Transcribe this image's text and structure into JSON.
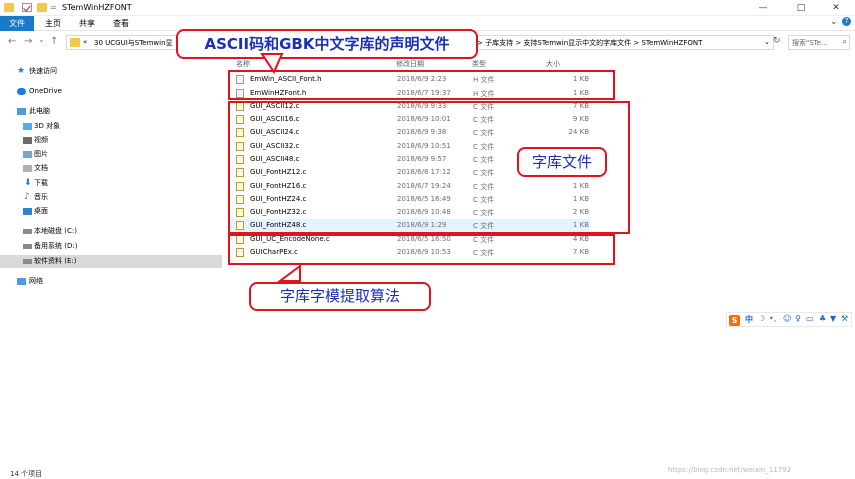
{
  "window": {
    "title": "STemWinHZFONT",
    "qa_separator": "=",
    "minimize": "—",
    "maximize": "□",
    "close": "✕"
  },
  "ribbon": {
    "tabs": [
      "文件",
      "主页",
      "共享",
      "查看"
    ],
    "expand_icon": "chevron-down-icon",
    "help_icon": "help-icon"
  },
  "address": {
    "back": "←",
    "forward": "→",
    "up_history": "⌄",
    "up": "↑",
    "crumb_lead": "«",
    "crumb_first": "30 UCGUI与STemwin显",
    "crumb_tail": ">  子库支持  >  支持STemwin显示中文的字库文件  >  STemWinHZFONT",
    "dropdown": "⌄",
    "refresh": "↻",
    "search_placeholder": "搜索\"STe...",
    "search_icon": "⌕"
  },
  "sidebar": {
    "items": [
      {
        "label": "快速访问",
        "icon": "star-icon"
      },
      {
        "label": "OneDrive",
        "icon": "cloud-icon"
      },
      {
        "label": "此电脑",
        "icon": "computer-icon"
      },
      {
        "label": "3D 对象",
        "icon": "cube-icon"
      },
      {
        "label": "视频",
        "icon": "video-icon"
      },
      {
        "label": "图片",
        "icon": "picture-icon"
      },
      {
        "label": "文档",
        "icon": "document-icon"
      },
      {
        "label": "下载",
        "icon": "download-icon"
      },
      {
        "label": "音乐",
        "icon": "music-icon"
      },
      {
        "label": "桌面",
        "icon": "desktop-icon"
      },
      {
        "label": "本地磁盘 (C:)",
        "icon": "drive-icon"
      },
      {
        "label": "备用系统 (D:)",
        "icon": "drive-icon"
      },
      {
        "label": "软件资料 (E:)",
        "icon": "drive-icon"
      },
      {
        "label": "网络",
        "icon": "network-icon"
      }
    ]
  },
  "columns": {
    "name": "名称",
    "date": "修改日期",
    "type": "类型",
    "size": "大小"
  },
  "files": [
    {
      "name": "EmWin_ASCII_Font.h",
      "date": "2018/6/9 2:23",
      "type": "H 文件",
      "size": "1 KB"
    },
    {
      "name": "EmWinHZFont.h",
      "date": "2018/6/7 19:37",
      "type": "H 文件",
      "size": "1 KB"
    },
    {
      "name": "GUI_ASCII12.c",
      "date": "2018/6/9 9:33",
      "type": "C 文件",
      "size": "7 KB"
    },
    {
      "name": "GUI_ASCII16.c",
      "date": "2018/6/9 10:01",
      "type": "C 文件",
      "size": "9 KB"
    },
    {
      "name": "GUI_ASCII24.c",
      "date": "2018/6/9 9:38",
      "type": "C 文件",
      "size": "24 KB"
    },
    {
      "name": "GUI_ASCII32.c",
      "date": "2018/6/9 10:51",
      "type": "C 文件",
      "size": ""
    },
    {
      "name": "GUI_ASCII48.c",
      "date": "2018/6/9 9:57",
      "type": "C 文件",
      "size": ""
    },
    {
      "name": "GUI_FontHZ12.c",
      "date": "2018/6/8 17:12",
      "type": "C 文件",
      "size": ""
    },
    {
      "name": "GUI_FontHZ16.c",
      "date": "2018/6/7 19:24",
      "type": "C 文件",
      "size": "1 KB"
    },
    {
      "name": "GUI_FontHZ24.c",
      "date": "2018/6/5 16:49",
      "type": "C 文件",
      "size": "1 KB"
    },
    {
      "name": "GUI_FontHZ32.c",
      "date": "2018/6/9 10:48",
      "type": "C 文件",
      "size": "2 KB"
    },
    {
      "name": "GUI_FontHZ48.c",
      "date": "2018/6/9 1:29",
      "type": "C 文件",
      "size": "1 KB"
    },
    {
      "name": "GUI_UC_EncodeNone.c",
      "date": "2018/6/5 16:50",
      "type": "C 文件",
      "size": "4 KB"
    },
    {
      "name": "GUICharPEx.c",
      "date": "2018/6/9 10:53",
      "type": "C 文件",
      "size": "7 KB"
    }
  ],
  "annotations": {
    "header_decl": "ASCII码和GBK中文字库的声明文件",
    "font_files": "字库文件",
    "algorithm": "字库字模提取算法",
    "color": "#e0141e"
  },
  "status": {
    "count": "14 个项目",
    "watermark": "https://blog.csdn.net/weixin_11792"
  },
  "ime": {
    "logo": "S",
    "mode": "中"
  }
}
